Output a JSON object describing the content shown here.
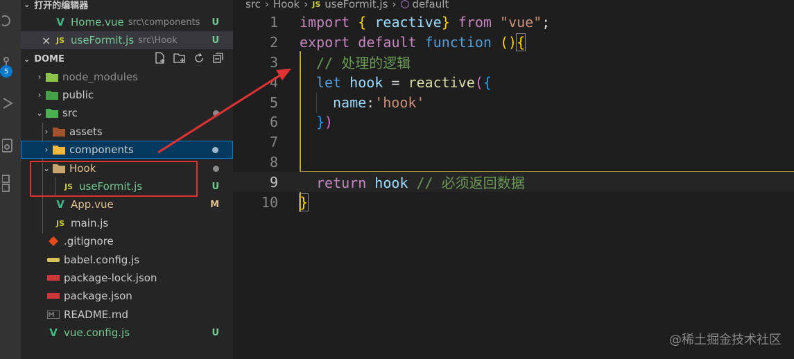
{
  "activity": {
    "badge": "5"
  },
  "sidebar": {
    "open_editors_title": "打开的编辑器",
    "open_editors": [
      {
        "name": "Home.vue",
        "path": "src\\components",
        "status": "U",
        "icon": "vue-icon"
      },
      {
        "name": "useFormit.js",
        "path": "src\\Hook",
        "status": "U",
        "icon": "js-icon",
        "close": "×"
      }
    ],
    "workspace_title": "DOME",
    "tree": [
      {
        "name": "node_modules",
        "icon": "node-modules-folder-icon"
      },
      {
        "name": "public",
        "icon": "public-folder-icon"
      },
      {
        "name": "src",
        "icon": "src-folder-icon"
      },
      {
        "name": "assets",
        "icon": "assets-folder-icon"
      },
      {
        "name": "components",
        "icon": "components-folder-icon"
      },
      {
        "name": "Hook",
        "icon": "folder-open-icon"
      },
      {
        "name": "useFormit.js",
        "status": "U",
        "icon": "js-icon"
      },
      {
        "name": "App.vue",
        "status": "M",
        "icon": "vue-icon"
      },
      {
        "name": "main.js",
        "icon": "js-icon"
      },
      {
        "name": ".gitignore",
        "icon": "git-icon"
      },
      {
        "name": "babel.config.js",
        "icon": "babel-icon"
      },
      {
        "name": "package-lock.json",
        "icon": "npm-icon"
      },
      {
        "name": "package.json",
        "icon": "npm-icon"
      },
      {
        "name": "README.md",
        "icon": "markdown-icon"
      },
      {
        "name": "vue.config.js",
        "status": "U",
        "icon": "vue-icon"
      }
    ]
  },
  "editor": {
    "breadcrumb": [
      "src",
      "Hook",
      "useFormit.js",
      "default"
    ],
    "lines": [
      {
        "n": "1",
        "import": "import",
        "obrace": "{",
        "reactive": " reactive",
        "cbrace": "}",
        "from": " from",
        "mod": "\"vue\"",
        "semi": ";"
      },
      {
        "n": "2",
        "export": "export",
        "default": "default",
        "function": "function",
        "paren": "()",
        "brace": "{"
      },
      {
        "n": "3",
        "comment": "// 处理的逻辑"
      },
      {
        "n": "4",
        "let": "let",
        "hook": " hook",
        "eq": " = ",
        "reactive": "reactive",
        "open": "(",
        "brace": "{"
      },
      {
        "n": "5",
        "key": "name",
        "colon": ":",
        "val": "'hook'"
      },
      {
        "n": "6",
        "close": "}",
        "paren": ")"
      },
      {
        "n": "7"
      },
      {
        "n": "8"
      },
      {
        "n": "9",
        "return": "return",
        "hook": " hook",
        "comment": " // 必须返回数据"
      },
      {
        "n": "10",
        "brace": "}"
      }
    ]
  },
  "watermark": "@稀土掘金技术社区",
  "colors": {
    "annotation_red": "#e03232",
    "selection": "#04395e",
    "accent": "#007acc"
  }
}
